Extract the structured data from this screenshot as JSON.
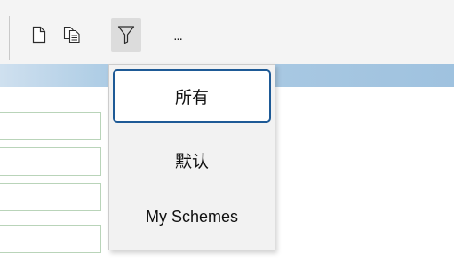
{
  "toolbar": {
    "buttons": [
      {
        "name": "new-document-icon",
        "kind": "icon"
      },
      {
        "name": "copy-document-icon",
        "kind": "icon"
      },
      {
        "name": "filter-icon",
        "kind": "icon",
        "active": true
      },
      {
        "name": "more-button",
        "label": "..."
      }
    ]
  },
  "filter_menu": {
    "items": [
      {
        "label": "所有",
        "selected": true
      },
      {
        "label": "默认",
        "selected": false
      },
      {
        "label": "My Schemes",
        "selected": false
      }
    ]
  },
  "colors": {
    "header_bar": "#a8c8e2",
    "selection_border": "#1e5a96",
    "cell_border": "#b9d4b9",
    "menu_background": "#f2f2f2"
  }
}
